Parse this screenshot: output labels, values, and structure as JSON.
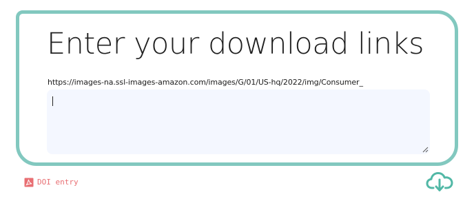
{
  "main": {
    "heading": "Enter your download links",
    "input_value": "https://images-na.ssl-images-amazon.com/images/G/01/US-hq/2022/img/Consumer_"
  },
  "footer": {
    "doi_label": "DOI entry"
  },
  "colors": {
    "accent": "#82c8bf",
    "doi": "#e86f73",
    "textarea_bg": "#f4f7ff"
  },
  "icons": {
    "doi": "pdf-icon",
    "download": "cloud-download-icon"
  }
}
